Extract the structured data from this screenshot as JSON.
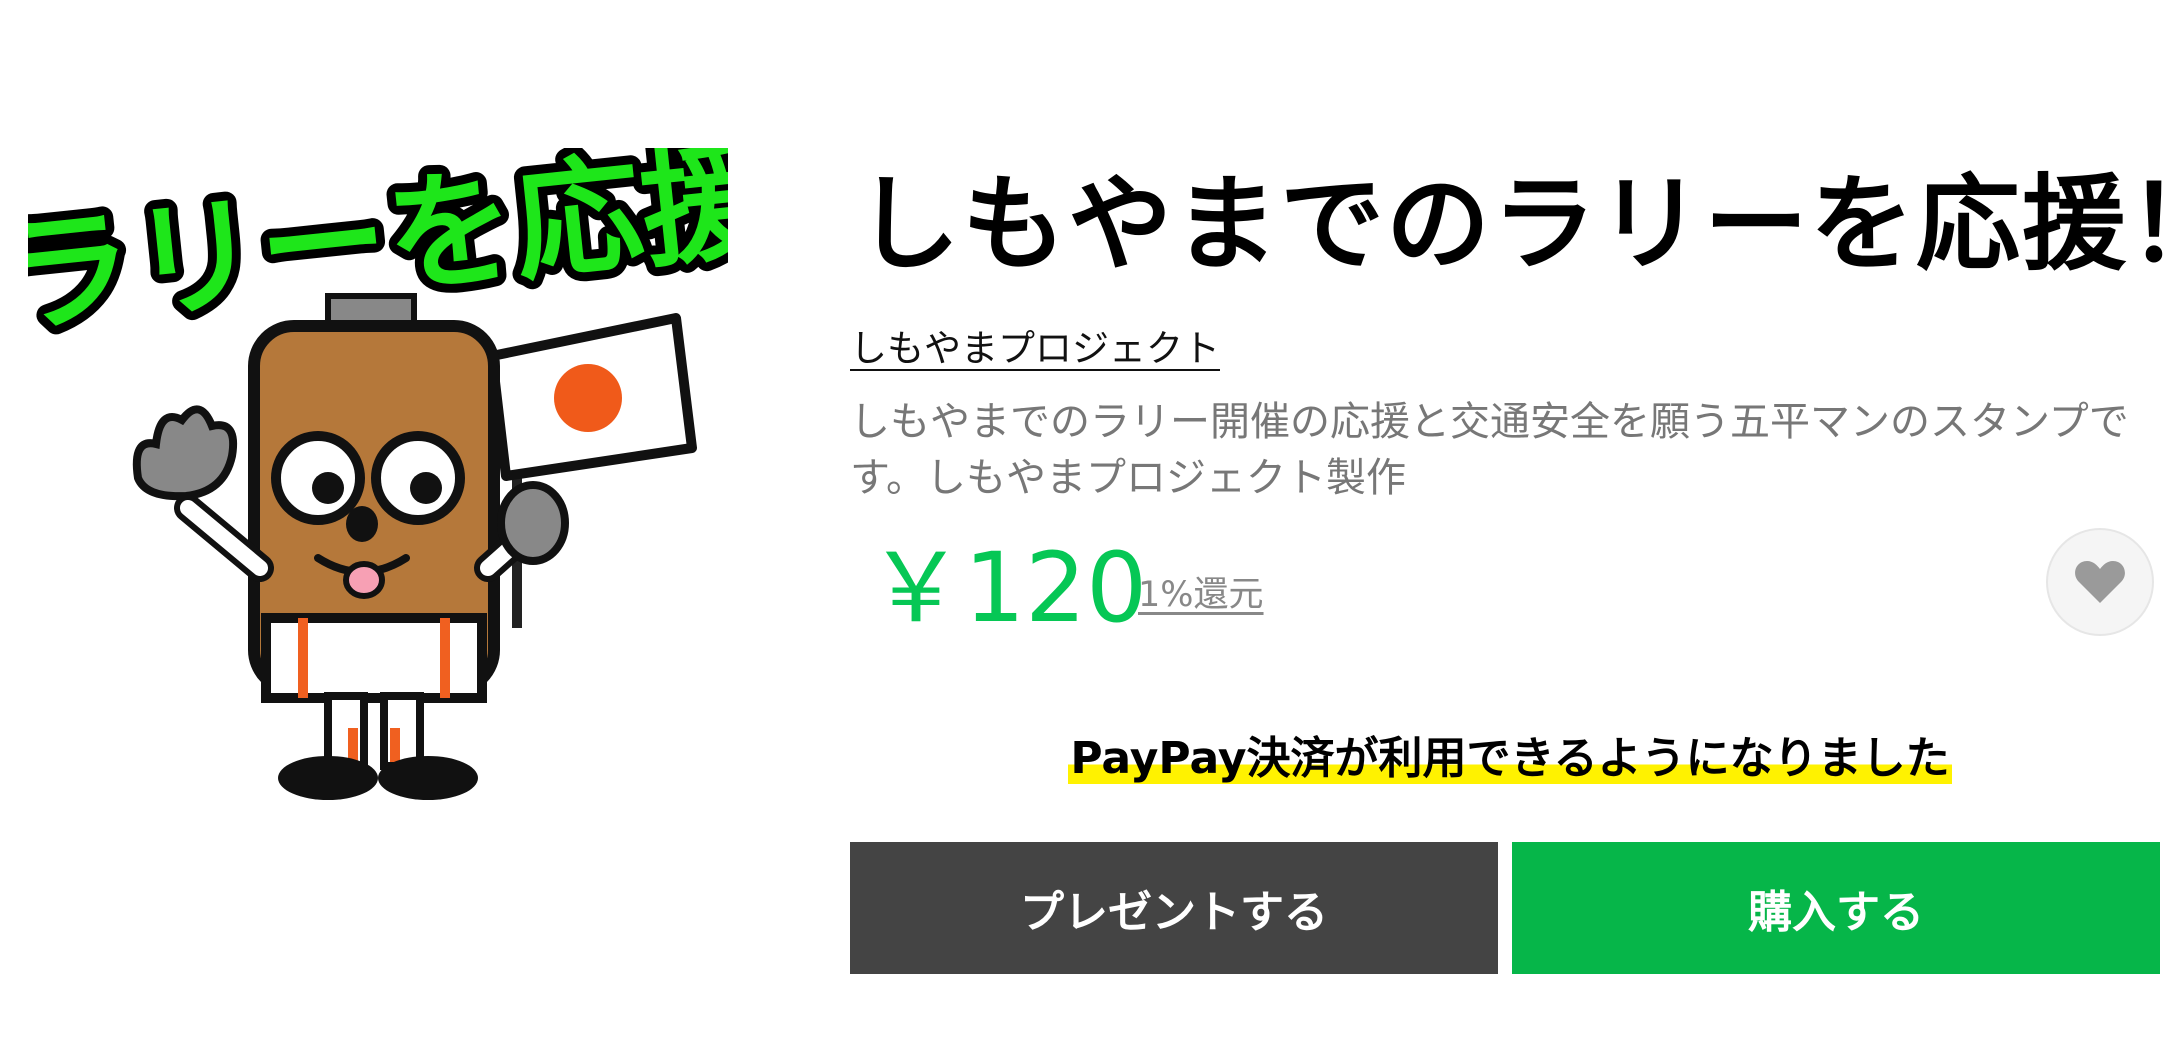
{
  "sticker": {
    "banner_text": "ラリーを応援"
  },
  "product": {
    "title": "しもやまでのラリーを応援！",
    "author": "しもやまプロジェクト",
    "description": "しもやまでのラリー開催の応援と交通安全を願う五平マンのスタンプです。しもやまプロジェクト製作",
    "price": "￥120",
    "cashback": "1%還元",
    "price_color": "#06c755"
  },
  "notice": {
    "text": "PayPay決済が利用できるようになりました",
    "highlight_color": "#fff200"
  },
  "actions": {
    "gift_label": "プレゼントする",
    "buy_label": "購入する",
    "gift_color": "#444444",
    "buy_color": "#06b649"
  },
  "icons": {
    "favorite": "heart-icon"
  }
}
